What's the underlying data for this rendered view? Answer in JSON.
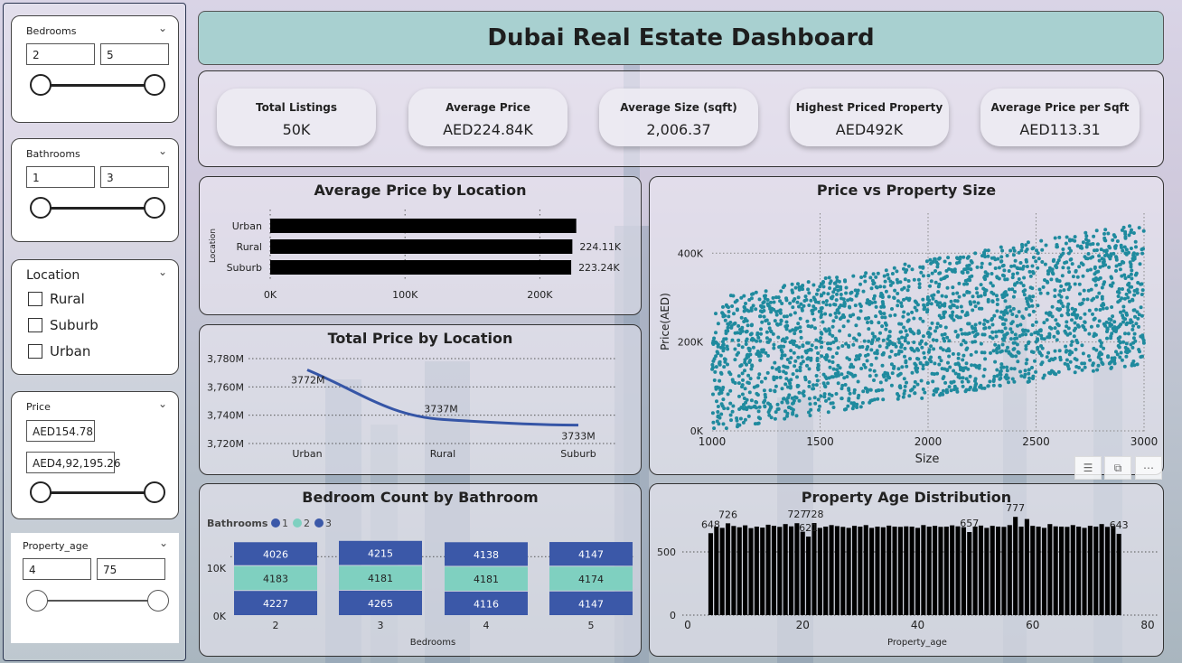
{
  "title": "Dubai Real Estate Dashboard",
  "slicers": {
    "bedrooms": {
      "label": "Bedrooms",
      "min": "2",
      "max": "5",
      "low": 0,
      "high": 1
    },
    "bathrooms": {
      "label": "Bathrooms",
      "min": "1",
      "max": "3",
      "low": 0,
      "high": 1
    },
    "location": {
      "label": "Location",
      "options": [
        "Rural",
        "Suburb",
        "Urban"
      ]
    },
    "price": {
      "label": "Price",
      "min": "AED154.78",
      "max": "AED4,92,195.26",
      "low": 0,
      "high": 1
    },
    "property_age": {
      "label": "Property_age",
      "min": "4",
      "max": "75",
      "low": 0,
      "high": 1
    }
  },
  "kpis": [
    {
      "label": "Total Listings",
      "value": "50K"
    },
    {
      "label": "Average Price",
      "value": "AED224.84K"
    },
    {
      "label": "Average Size (sqft)",
      "value": "2,006.37"
    },
    {
      "label": "Highest Priced Property",
      "value": "AED492K"
    },
    {
      "label": "Average Price per Sqft",
      "value": "AED113.31"
    }
  ],
  "colors": {
    "accent": "#1f8a9e",
    "line": "#3555a6",
    "stack1": "#3b58a8",
    "stack2": "#7fd0c0",
    "title_bar": "#a8d0d0"
  },
  "toolbar": {
    "icons": [
      "filter-icon",
      "focus-mode-icon",
      "more-options-icon"
    ]
  },
  "chart_data": [
    {
      "id": "avg_price_by_location",
      "type": "bar",
      "orientation": "horizontal",
      "title": "Average Price by Location",
      "ylabel": "Location",
      "categories": [
        "Urban",
        "Rural",
        "Suburb"
      ],
      "values": [
        227000,
        224110,
        223240
      ],
      "data_labels": [
        "",
        "224.11K",
        "223.24K"
      ],
      "xticks": [
        "0K",
        "100K",
        "200K"
      ],
      "xlim": [
        0,
        250000
      ]
    },
    {
      "id": "total_price_by_location",
      "type": "line",
      "title": "Total Price by Location",
      "categories": [
        "Urban",
        "Rural",
        "Suburb"
      ],
      "values": [
        3772,
        3737,
        3733
      ],
      "data_labels": [
        "3772M",
        "3737M",
        "3733M"
      ],
      "yticks": [
        "3,720M",
        "3,740M",
        "3,760M",
        "3,780M"
      ],
      "ylim": [
        3720,
        3780
      ]
    },
    {
      "id": "price_vs_size",
      "type": "scatter",
      "title": "Price vs Property Size",
      "xlabel": "Size",
      "ylabel": "Price(AED)",
      "xlim": [
        1000,
        3000
      ],
      "ylim": [
        0,
        490000
      ],
      "xticks": [
        "1000",
        "1500",
        "2000",
        "2500",
        "3000"
      ],
      "yticks": [
        "0K",
        "200K",
        "400K"
      ],
      "trend": {
        "x": [
          1000,
          3000
        ],
        "y_low": [
          0,
          150000
        ],
        "y_high": [
          300000,
          470000
        ]
      }
    },
    {
      "id": "bedroom_count_by_bathroom",
      "type": "bar",
      "stacked": true,
      "title": "Bedroom Count by Bathroom",
      "legend_title": "Bathrooms",
      "xlabel": "Bedrooms",
      "categories": [
        "2",
        "3",
        "4",
        "5"
      ],
      "series": [
        {
          "name": "1",
          "values": [
            4227,
            4265,
            4116,
            4147
          ]
        },
        {
          "name": "2",
          "values": [
            4183,
            4181,
            4181,
            4174
          ]
        },
        {
          "name": "3",
          "values": [
            4026,
            4215,
            4138,
            4147
          ]
        }
      ],
      "yticks": [
        "0K",
        "10K"
      ],
      "ylim": [
        0,
        14000
      ]
    },
    {
      "id": "property_age_distribution",
      "type": "bar",
      "title": "Property Age Distribution",
      "xlabel": "Property_age",
      "xlim": [
        0,
        80
      ],
      "ylim": [
        0,
        800
      ],
      "xticks": [
        "0",
        "20",
        "40",
        "60",
        "80"
      ],
      "yticks": [
        "0",
        "500"
      ],
      "x": [
        4,
        5,
        6,
        7,
        8,
        9,
        10,
        11,
        12,
        13,
        14,
        15,
        16,
        17,
        18,
        19,
        20,
        21,
        22,
        23,
        24,
        25,
        26,
        27,
        28,
        29,
        30,
        31,
        32,
        33,
        34,
        35,
        36,
        37,
        38,
        39,
        40,
        41,
        42,
        43,
        44,
        45,
        46,
        47,
        48,
        49,
        50,
        51,
        52,
        53,
        54,
        55,
        56,
        57,
        58,
        59,
        60,
        61,
        62,
        63,
        64,
        65,
        66,
        67,
        68,
        69,
        70,
        71,
        72,
        73,
        74,
        75
      ],
      "values": [
        648,
        700,
        690,
        726,
        705,
        695,
        710,
        688,
        700,
        692,
        715,
        706,
        698,
        720,
        702,
        727,
        660,
        621,
        728,
        690,
        700,
        712,
        704,
        698,
        690,
        706,
        700,
        712,
        690,
        700,
        695,
        708,
        700,
        698,
        702,
        700,
        690,
        712,
        700,
        706,
        698,
        700,
        710,
        702,
        696,
        657,
        700,
        708,
        690,
        706,
        700,
        698,
        712,
        777,
        700,
        760,
        706,
        700,
        690,
        720,
        702,
        700,
        698,
        712,
        700,
        690,
        706,
        700,
        720,
        698,
        705,
        643
      ],
      "data_labels": [
        {
          "x": 4,
          "label": "648"
        },
        {
          "x": 7,
          "label": "726"
        },
        {
          "x": 19,
          "label": "727"
        },
        {
          "x": 21,
          "label": "621"
        },
        {
          "x": 22,
          "label": "728"
        },
        {
          "x": 49,
          "label": "657"
        },
        {
          "x": 57,
          "label": "777"
        },
        {
          "x": 75,
          "label": "643"
        }
      ]
    }
  ]
}
